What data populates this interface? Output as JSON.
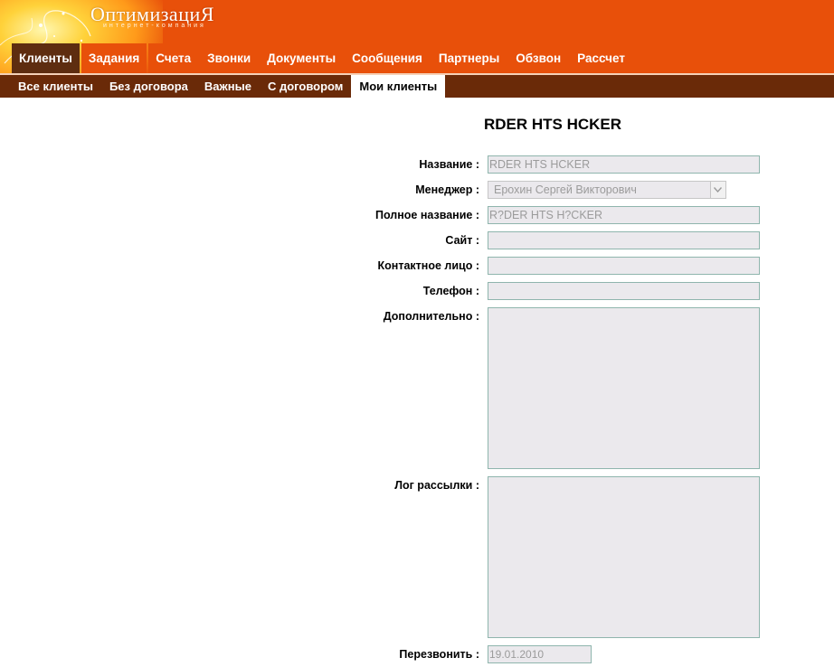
{
  "brand": {
    "logo_text": "ОптимизациЯ",
    "logo_sub": "интернет-компания",
    "colors": {
      "header": "#e8500a",
      "tab_active": "#5e2d10",
      "subnav": "#6a2a08",
      "field_bg": "#ebe9ed",
      "field_border": "#8fb5ad"
    }
  },
  "tabs": [
    {
      "label": "Клиенты",
      "active": true
    },
    {
      "label": "Задания"
    },
    {
      "label": "Счета"
    },
    {
      "label": "Звонки"
    },
    {
      "label": "Документы"
    },
    {
      "label": "Сообщения"
    },
    {
      "label": "Партнеры"
    },
    {
      "label": "Обзвон"
    },
    {
      "label": "Рассчет"
    }
  ],
  "subnav": [
    {
      "label": "Все клиенты"
    },
    {
      "label": "Без договора"
    },
    {
      "label": "Важные"
    },
    {
      "label": "С договором"
    },
    {
      "label": "Мои клиенты",
      "active": true
    }
  ],
  "form": {
    "title": "RDER HTS HCKER",
    "name_label": "Название :",
    "name_value": "RDER HTS HCKER",
    "manager_label": "Менеджер :",
    "manager_value": "Ерохин Сергей Викторович",
    "fullname_label": "Полное название :",
    "fullname_value": "R?DER HTS H?CKER",
    "site_label": "Сайт :",
    "site_value": "",
    "contact_label": "Контактное лицо :",
    "contact_value": "",
    "phone_label": "Телефон :",
    "phone_value": "",
    "extra_label": "Дополнительно :",
    "log_label": "Лог рассылки :",
    "callback_label": "Перезвонить :",
    "callback_value": "19.01.2010"
  },
  "icons": {
    "dropdown": "chevron-down-icon"
  }
}
